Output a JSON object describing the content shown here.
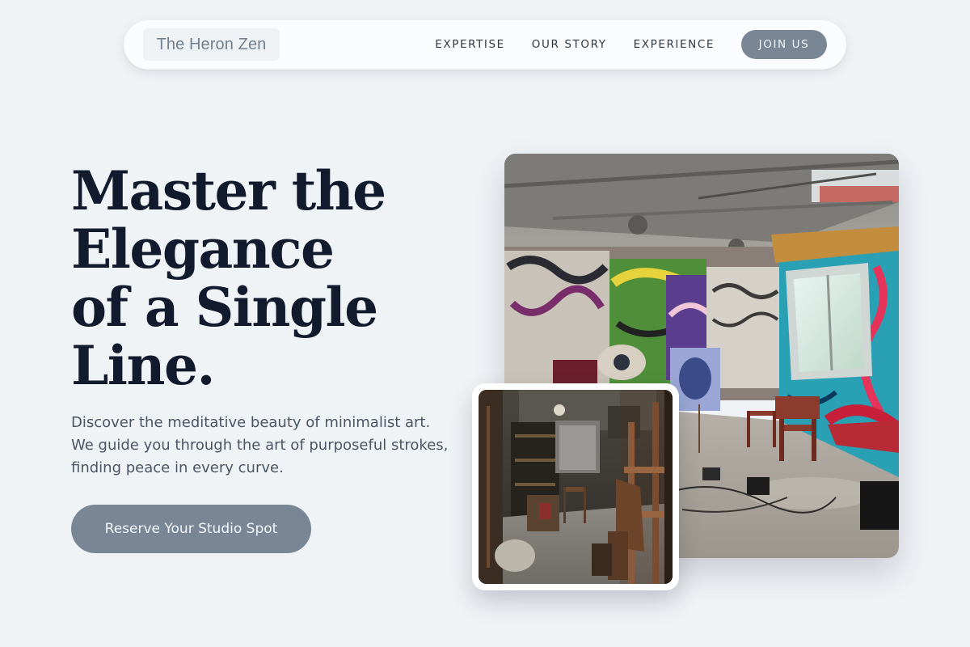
{
  "nav": {
    "brand": "The Heron Zen",
    "links": [
      "EXPERTISE",
      "OUR STORY",
      "EXPERIENCE"
    ],
    "cta": "JOIN US"
  },
  "hero": {
    "title_lines": [
      "Master the",
      "Elegance",
      "of a Single",
      "Line."
    ],
    "subtitle": "Discover the meditative beauty of minimalist art. We guide you through the art of purposeful strokes, finding peace in every curve.",
    "cta": "Reserve Your Studio Spot"
  },
  "images": {
    "main": "graffiti-art-studio-photo",
    "secondary": "artist-workshop-easels-photo"
  },
  "colors": {
    "background": "#f0f3f6",
    "accent": "#788696",
    "heading": "#121a2e",
    "body_text": "#4b5563"
  }
}
